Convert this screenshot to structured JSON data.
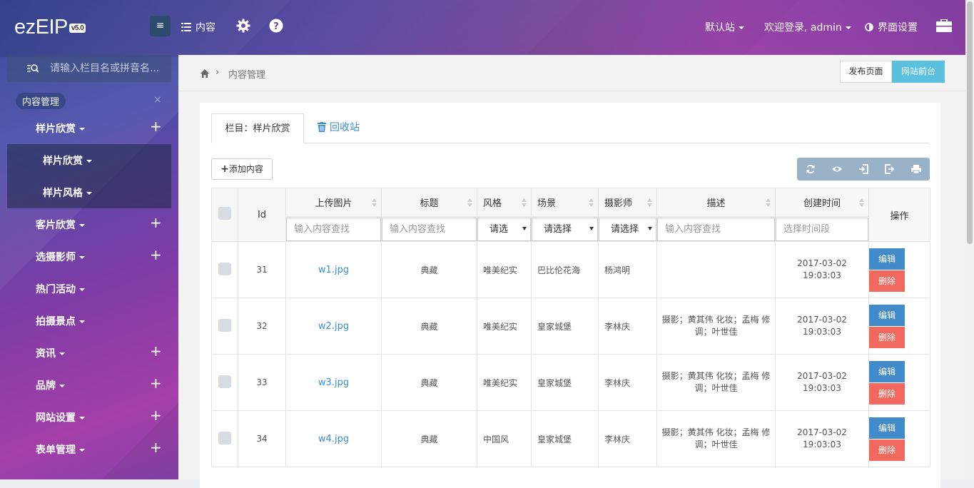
{
  "app": {
    "logo": "ezEIP",
    "version": "v5.0"
  },
  "topbar": {
    "content_label": "内容",
    "site_select": "默认站",
    "welcome": "欢迎登录, admin",
    "ui_settings": "界面设置"
  },
  "sidebar": {
    "search_placeholder": "请输入栏目名或拼音名...",
    "section_title": "内容管理",
    "items": [
      {
        "label": "样片欣赏",
        "expandable": true
      },
      {
        "label": "样片欣赏",
        "sub": true
      },
      {
        "label": "样片风格",
        "sub": true
      },
      {
        "label": "客片欣赏",
        "expandable": true
      },
      {
        "label": "选摄影师",
        "expandable": true
      },
      {
        "label": "热门活动",
        "expandable": false
      },
      {
        "label": "拍摄景点",
        "expandable": false
      },
      {
        "label": "资讯",
        "expandable": true
      },
      {
        "label": "品牌",
        "expandable": true
      },
      {
        "label": "网站设置",
        "expandable": true
      },
      {
        "label": "表单管理",
        "expandable": true
      }
    ]
  },
  "breadcrumb": {
    "label": "内容管理"
  },
  "actions": {
    "publish": "发布页面",
    "front": "网站前台"
  },
  "tabs": {
    "active": "栏目：样片欣赏",
    "recycle": "回收站"
  },
  "buttons": {
    "add": "添加内容"
  },
  "table": {
    "headers": {
      "id": "Id",
      "image": "上传图片",
      "title": "标题",
      "style": "风格",
      "scene": "场景",
      "photographer": "摄影师",
      "desc": "描述",
      "created": "创建时间",
      "ops": "操作"
    },
    "filters": {
      "image": "输入内容查找",
      "title": "输入内容查找",
      "style": "请选",
      "scene": "请选择",
      "photographer": "请选择",
      "desc": "输入内容查找",
      "created": "选择时间段"
    },
    "rows": [
      {
        "id": "31",
        "image": "w1.jpg",
        "title": "典藏",
        "style": "唯美纪实",
        "scene": "巴比伦花海",
        "photographer": "杨鸿明",
        "desc": "",
        "date": "2017-03-02",
        "time": "19:03:03"
      },
      {
        "id": "32",
        "image": "w2.jpg",
        "title": "典藏",
        "style": "唯美纪实",
        "scene": "皇家城堡",
        "photographer": "李林庆",
        "desc": "摄影；黄其伟 化妆；孟梅 修调；叶世佳",
        "date": "2017-03-02",
        "time": "19:03:03"
      },
      {
        "id": "33",
        "image": "w3.jpg",
        "title": "典藏",
        "style": "唯美纪实",
        "scene": "皇家城堡",
        "photographer": "李林庆",
        "desc": "摄影；黄其伟 化妆；孟梅 修调；叶世佳",
        "date": "2017-03-02",
        "time": "19:03:03"
      },
      {
        "id": "34",
        "image": "w4.jpg",
        "title": "典藏",
        "style": "中国风",
        "scene": "皇家城堡",
        "photographer": "李林庆",
        "desc": "摄影；黄其伟 化妆；孟梅 修调；叶世佳",
        "date": "2017-03-02",
        "time": "19:03:03"
      }
    ],
    "edit_label": "编辑",
    "delete_label": "删除"
  },
  "colors": {
    "primary": "#428bca",
    "danger": "#f0685e",
    "info": "#5bc0de",
    "link": "#3a8fd4"
  }
}
